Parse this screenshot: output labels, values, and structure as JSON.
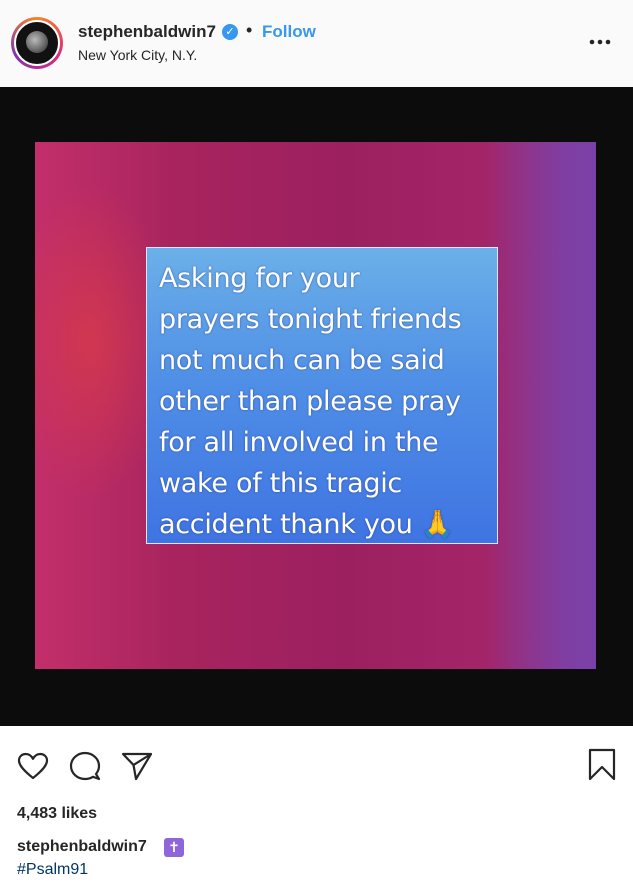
{
  "header": {
    "username": "stephenbaldwin7",
    "verified_mark": "✓",
    "separator": "•",
    "follow_label": "Follow",
    "location": "New York City, N.Y."
  },
  "post": {
    "message": "Asking for your\nprayers tonight friends\nnot much can be said\nother than please pray\nfor all involved in the\nwake of this tragic\naccident thank you 🙏",
    "card_color": "#4f8fe6",
    "background_color": "#a8245e"
  },
  "actions": {
    "like_icon": "heart-icon",
    "comment_icon": "comment-icon",
    "share_icon": "share-icon",
    "save_icon": "bookmark-icon"
  },
  "likes": "4,483 likes",
  "caption": {
    "username": "stephenbaldwin7",
    "badge": "✝",
    "hashtag": "#Psalm91"
  }
}
